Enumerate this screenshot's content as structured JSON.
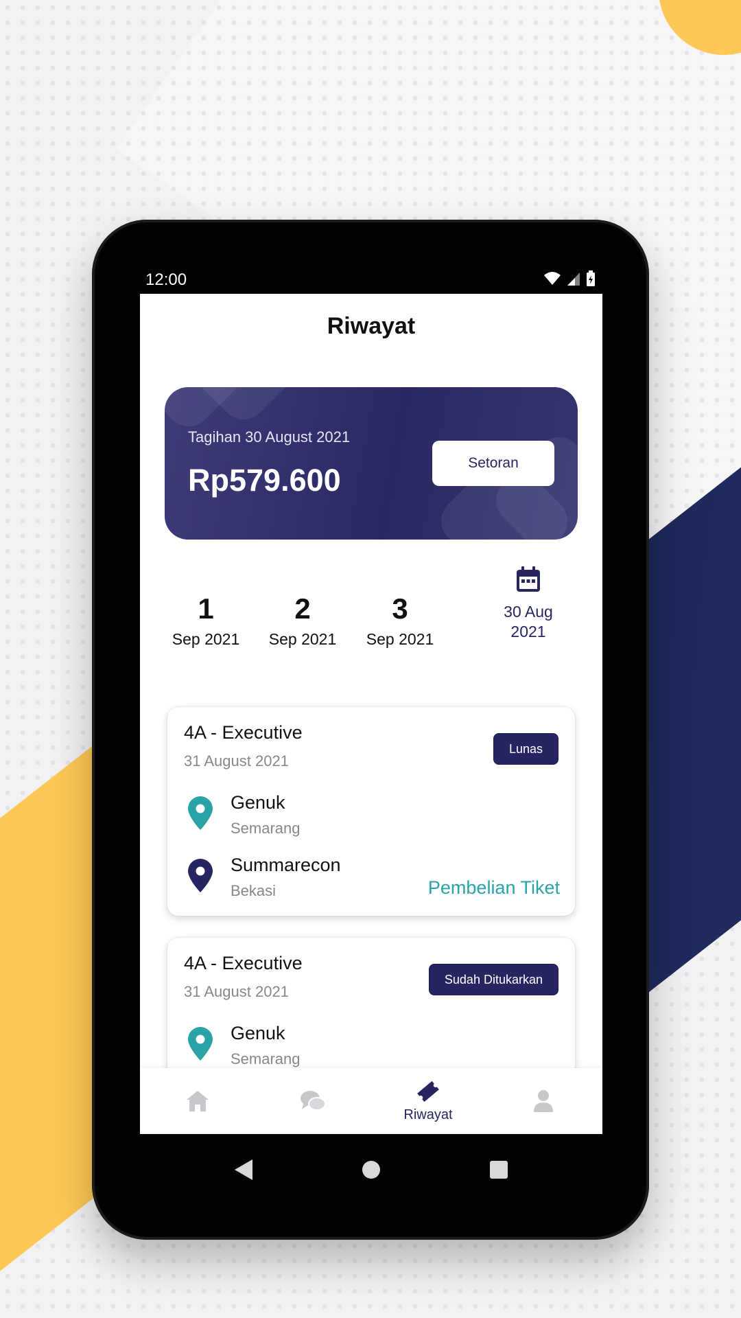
{
  "status_bar": {
    "time": "12:00"
  },
  "page": {
    "title": "Riwayat"
  },
  "bill": {
    "label": "Tagihan 30 August 2021",
    "amount": "Rp579.600",
    "button_label": "Setoran"
  },
  "dates": {
    "items": [
      {
        "day": "1",
        "month_year": "Sep 2021"
      },
      {
        "day": "2",
        "month_year": "Sep 2021"
      },
      {
        "day": "3",
        "month_year": "Sep 2021"
      }
    ],
    "picker": {
      "line1": "30 Aug",
      "line2": "2021",
      "icon": "calendar-icon"
    }
  },
  "trips": [
    {
      "title": "4A - Executive",
      "date": "31 August 2021",
      "status": "Lunas",
      "origin": {
        "name": "Genuk",
        "city": "Semarang"
      },
      "destination": {
        "name": "Summarecon",
        "city": "Bekasi"
      },
      "type": "Pembelian Tiket"
    },
    {
      "title": "4A - Executive",
      "date": "31 August 2021",
      "status": "Sudah Ditukarkan",
      "origin": {
        "name": "Genuk",
        "city": "Semarang"
      }
    }
  ],
  "bottom_nav": {
    "items": [
      {
        "icon": "home-icon",
        "label": ""
      },
      {
        "icon": "chat-icon",
        "label": ""
      },
      {
        "icon": "ticket-icon",
        "label": "Riwayat",
        "active": true
      },
      {
        "icon": "profile-icon",
        "label": ""
      }
    ]
  },
  "colors": {
    "primary": "#262561",
    "accent_teal": "#2aa3a7",
    "brand_yellow": "#fdc856",
    "navy_band": "#1a2456"
  }
}
